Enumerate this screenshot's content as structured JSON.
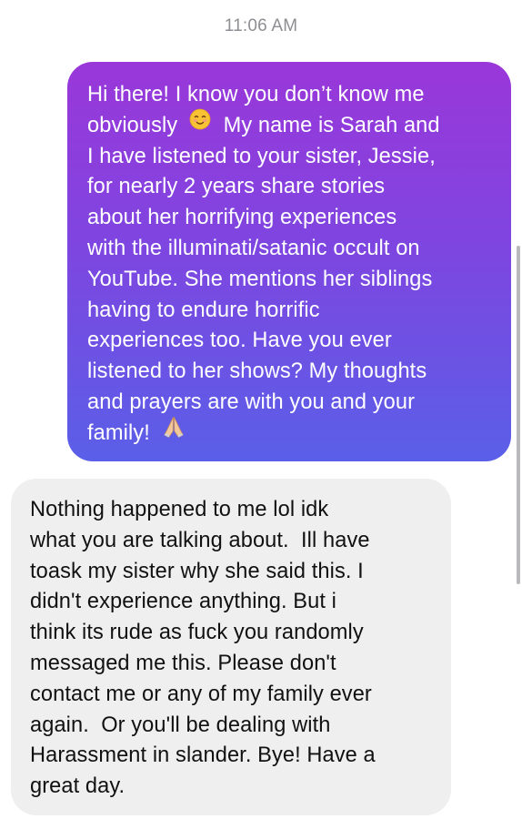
{
  "timestamp": "11:06 AM",
  "outgoing": {
    "lines": [
      "Hi there! I know you don’t know me",
      "obviously",
      "My name is Sarah and",
      "I have listened to your sister, Jessie,",
      "for nearly 2 years share stories",
      "about her horrifying experiences",
      "with the illuminati/satanic occult on",
      "YouTube. She mentions her siblings",
      "having to endure horrific",
      "experiences too. Have you ever",
      "listened to her shows? My thoughts",
      "and prayers are with you and your",
      "family!"
    ],
    "emojis": [
      "smiling-blushing-face-icon",
      "folded-hands-icon"
    ],
    "colors": {
      "top": "#9a37d9",
      "bottom": "#5a5fe8"
    }
  },
  "incoming": {
    "lines": [
      "Nothing happened to me lol idk",
      "what you are talking about.  Ill have",
      "toask my sister why she said this. I",
      "didn't experience anything. But i",
      "think its rude as fuck you randomly",
      "messaged me this. Please don't",
      "contact me or any of my family ever",
      "again.  Or you'll be dealing with",
      "Harassment in slander. Bye! Have a",
      "great day."
    ],
    "colors": {
      "background": "#efefef"
    }
  }
}
